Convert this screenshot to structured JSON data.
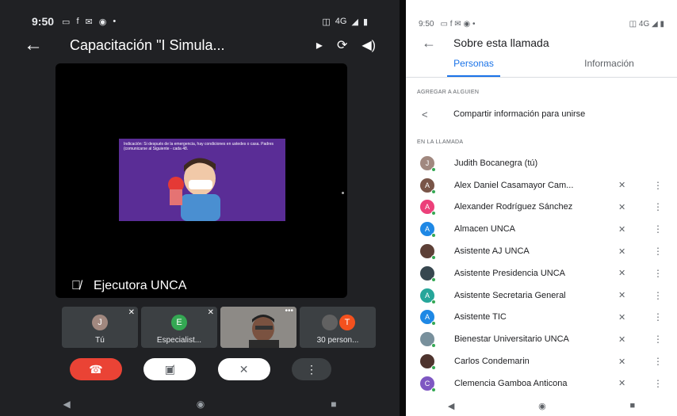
{
  "left": {
    "status": {
      "time": "9:50",
      "network": "4G"
    },
    "call_title": "Capacitación \"I Simula...",
    "slide_text": "Indicación: Si después de la emergencia, hay condiciones en ustedes o casa. Padres (comunicarse al Siguiente - cada 48.",
    "speaker": "Ejecutora UNCA",
    "thumbnails": [
      {
        "initial": "J",
        "label": "Tú",
        "color": "#a1887f"
      },
      {
        "initial": "E",
        "label": "Especialist...",
        "color": "#34a853"
      },
      {
        "initial": "",
        "label": "",
        "color": "#6b6b6b"
      },
      {
        "initial": "T",
        "label": "30 person...",
        "color": "#f4511e"
      }
    ]
  },
  "right": {
    "status": {
      "time": "9:50",
      "network": "4G"
    },
    "title": "Sobre esta llamada",
    "tabs": [
      "Personas",
      "Información"
    ],
    "add_section": "AGREGAR A ALGUIEN",
    "share_label": "Compartir información para unirse",
    "in_call_section": "EN LA LLAMADA",
    "participants": [
      {
        "initial": "J",
        "name": "Judith Bocanegra (tú)",
        "color": "#a1887f",
        "muted": false
      },
      {
        "initial": "A",
        "name": "Alex Daniel Casamayor Cam...",
        "color": "#795548",
        "muted": true
      },
      {
        "initial": "A",
        "name": "Alexander Rodríguez Sánchez",
        "color": "#ec407a",
        "muted": true
      },
      {
        "initial": "A",
        "name": "Almacen UNCA",
        "color": "#1e88e5",
        "muted": true
      },
      {
        "initial": "",
        "name": "Asistente AJ UNCA",
        "color": "#5d4037",
        "muted": true
      },
      {
        "initial": "",
        "name": "Asistente Presidencia UNCA",
        "color": "#37474f",
        "muted": true
      },
      {
        "initial": "A",
        "name": "Asistente Secretaria General",
        "color": "#26a69a",
        "muted": true
      },
      {
        "initial": "A",
        "name": "Asistente TIC",
        "color": "#1e88e5",
        "muted": true
      },
      {
        "initial": "",
        "name": "Bienestar Universitario UNCA",
        "color": "#78909c",
        "muted": true
      },
      {
        "initial": "",
        "name": "Carlos Condemarin",
        "color": "#4e342e",
        "muted": true
      },
      {
        "initial": "C",
        "name": "Clemencia Gamboa Anticona",
        "color": "#7e57c2",
        "muted": true
      }
    ]
  }
}
